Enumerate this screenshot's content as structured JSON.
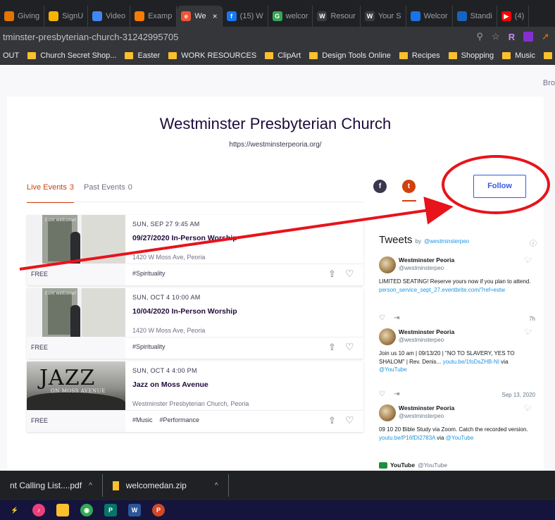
{
  "browser": {
    "tabs": [
      {
        "label": "Giving",
        "fav_color": "#e37400",
        "active": false
      },
      {
        "label": "SignU",
        "fav_color": "#f4b400",
        "active": false
      },
      {
        "label": "Video",
        "fav_color": "#4285f4",
        "active": false
      },
      {
        "label": "Examp",
        "fav_color": "#f57c00",
        "active": false
      },
      {
        "label": "We",
        "fav_color": "#f05537",
        "active": true
      },
      {
        "label": "(15) W",
        "fav_color": "#1877f2",
        "active": false
      },
      {
        "label": "welcor",
        "fav_color": "#34a853",
        "active": false
      },
      {
        "label": "Resour",
        "fav_color": "#3c3c3c",
        "active": false
      },
      {
        "label": "Your S",
        "fav_color": "#3c3c3c",
        "active": false
      },
      {
        "label": "Welcor",
        "fav_color": "#1a73e8",
        "active": false
      },
      {
        "label": "Standi",
        "fav_color": "#1565c0",
        "active": false
      },
      {
        "label": "(4)",
        "fav_color": "#ff0000",
        "active": false
      }
    ],
    "url": "tminster-presbyterian-church-31242995705",
    "ext_r": "R",
    "bookmarks": [
      {
        "label": "OUT",
        "folder": false
      },
      {
        "label": "Church Secret Shop...",
        "folder": true
      },
      {
        "label": "Easter",
        "folder": true
      },
      {
        "label": "WORK RESOURCES",
        "folder": true
      },
      {
        "label": "ClipArt",
        "folder": true
      },
      {
        "label": "Design Tools Online",
        "folder": true
      },
      {
        "label": "Recipes",
        "folder": true
      },
      {
        "label": "Shopping",
        "folder": true
      },
      {
        "label": "Music",
        "folder": true
      },
      {
        "label": "Bi",
        "folder": true
      }
    ]
  },
  "page": {
    "corner_text": "Bro",
    "organizer": {
      "name": "Westminster Presbyterian Church",
      "url": "https://westminsterpeoria.org/"
    },
    "tabs": {
      "live_label": "Live Events",
      "live_count": "3",
      "past_label": "Past Events",
      "past_count": "0"
    },
    "social": {
      "facebook": "f",
      "twitter": "t"
    },
    "follow_label": "Follow",
    "events": [
      {
        "date": "SUN, SEP 27 9:45 AM",
        "title": "09/27/2020 In-Person Worship",
        "venue": "1420 W Moss Ave, Peoria",
        "price": "FREE",
        "tags": [
          "#Spirituality"
        ],
        "image_caption": "I am welcome!"
      },
      {
        "date": "SUN, OCT 4 10:00 AM",
        "title": "10/04/2020 In-Person Worship",
        "venue": "1420 W Moss Ave, Peoria",
        "price": "FREE",
        "tags": [
          "#Spirituality"
        ],
        "image_caption": "I am welcome!"
      },
      {
        "date": "SUN, OCT 4 4:00 PM",
        "title": "Jazz on Moss Avenue",
        "venue": "Westminster Presbyterian Church, Peoria",
        "price": "FREE",
        "tags": [
          "#Music",
          "#Performance"
        ],
        "image_word": "JAZZ",
        "image_sub": "ON MOSS AVENUE"
      }
    ],
    "tweets": {
      "title": "Tweets",
      "by": "by",
      "handle": "@westminsterpeo",
      "items": [
        {
          "name": "Westminster Peoria",
          "user": "@westminsterpeo",
          "text": "LIMITED SEATING! Reserve yours now if you plan to attend. ",
          "link": "person_service_sept_27.eventbrite.com/?ref=estw",
          "time": "7h"
        },
        {
          "name": "Westminster Peoria",
          "user": "@westminsterpeo",
          "text": "Join us 10 am | 09/13/20 | \"NO TO SLAVERY, YES TO SHALOM\" | Rev. Denis... ",
          "link": "youtu.be/1foDsZHB-NI",
          "via": " via ",
          "via_handle": "@YouTube",
          "time": "Sep 13, 2020"
        },
        {
          "name": "Westminster Peoria",
          "user": "@westminsterpeo",
          "text": "09 10 20 Bible Study via Zoom. Catch the recorded version. ",
          "link": "youtu.be/P16fDI2783A",
          "via": " via ",
          "via_handle": "@YouTube"
        }
      ],
      "footer_name": "YouTube",
      "footer_user": "@YouTube"
    }
  },
  "downloads": [
    {
      "label": "nt Calling List....pdf",
      "icon": "pdf-icon"
    },
    {
      "label": "welcomedan.zip",
      "icon": "zip-icon"
    }
  ],
  "taskbar": [
    {
      "name": "bolt-icon",
      "color": "#3b82f6",
      "glyph": "⚡"
    },
    {
      "name": "itunes-icon",
      "color": "#ec407a",
      "glyph": "♪"
    },
    {
      "name": "file-explorer-icon",
      "color": "#fbc02d",
      "glyph": ""
    },
    {
      "name": "chrome-icon",
      "color": "#34a853",
      "glyph": "◉"
    },
    {
      "name": "publisher-icon",
      "color": "#077568",
      "glyph": "P"
    },
    {
      "name": "word-icon",
      "color": "#2b579a",
      "glyph": "W"
    },
    {
      "name": "powerpoint-icon",
      "color": "#d24726",
      "glyph": "P"
    }
  ],
  "colors": {
    "accent": "#d1410c",
    "follow": "#3659e3",
    "annotation": "#e8131b"
  }
}
